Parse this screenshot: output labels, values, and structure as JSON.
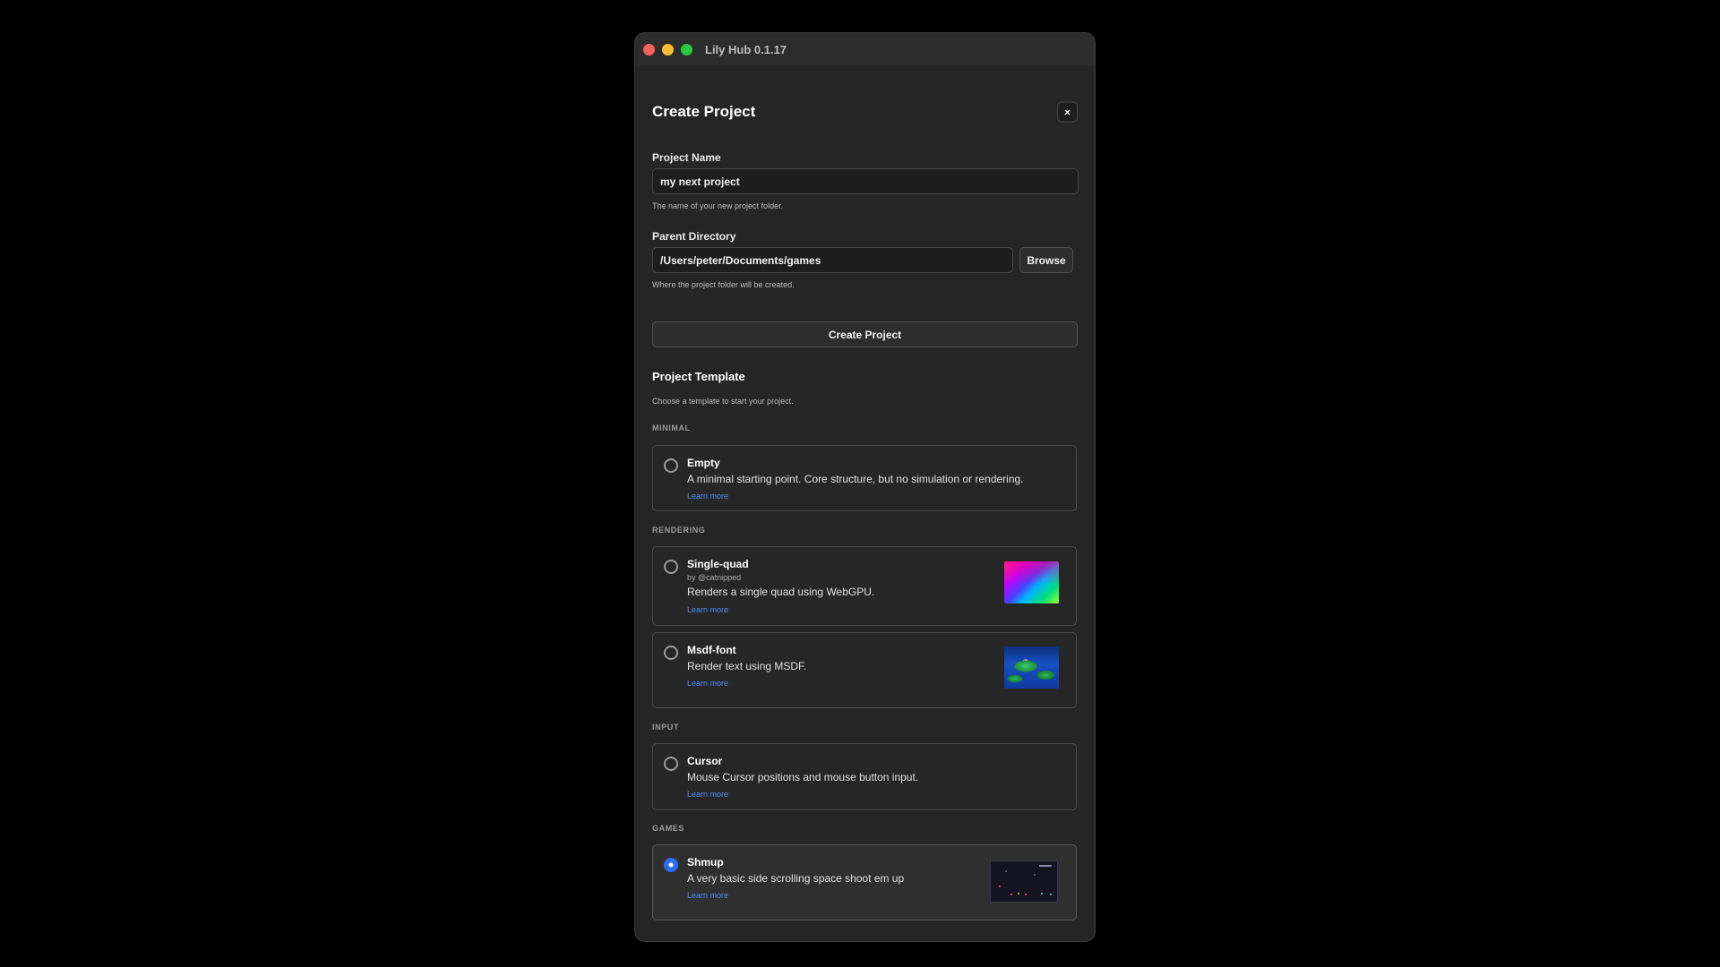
{
  "window": {
    "title": "Lily Hub 0.1.17"
  },
  "dialog": {
    "title": "Create Project",
    "close_glyph": "×"
  },
  "form": {
    "project_name": {
      "label": "Project Name",
      "value": "my next project",
      "help": "The name of your new project folder."
    },
    "parent_directory": {
      "label": "Parent Directory",
      "value": "/Users/peter/Documents/games",
      "help": "Where the project folder will be created.",
      "browse_label": "Browse"
    },
    "create_label": "Create Project"
  },
  "templates": {
    "title": "Project Template",
    "subtitle": "Choose a template to start your project.",
    "link_label": "Learn more",
    "categories": [
      {
        "name": "MINIMAL",
        "items": [
          {
            "name": "Empty",
            "author": "",
            "description": "A minimal starting point. Core structure, but no simulation or rendering.",
            "selected": false,
            "thumbnail": "none"
          }
        ]
      },
      {
        "name": "RENDERING",
        "items": [
          {
            "name": "Single-quad",
            "author": "by @catnipped",
            "description": "Renders a single quad using WebGPU.",
            "selected": false,
            "thumbnail": "gradient-quad"
          },
          {
            "name": "Msdf-font",
            "author": "",
            "description": "Render text using MSDF.",
            "selected": false,
            "thumbnail": "lily-pond"
          }
        ]
      },
      {
        "name": "INPUT",
        "items": [
          {
            "name": "Cursor",
            "author": "",
            "description": "Mouse Cursor positions and mouse button input.",
            "selected": false,
            "thumbnail": "none"
          }
        ]
      },
      {
        "name": "GAMES",
        "items": [
          {
            "name": "Shmup",
            "author": "",
            "description": "A very basic side scrolling space shoot em up",
            "selected": true,
            "thumbnail": "space-shooter"
          }
        ]
      }
    ]
  },
  "footer": {
    "console_glyph": ">_"
  },
  "colors": {
    "accent": "#2b6ef6",
    "link": "#4d8ff7",
    "background": "#252525",
    "traffic_close": "#fe5f57",
    "traffic_minimize": "#febc2e",
    "traffic_maximize": "#28c840"
  }
}
